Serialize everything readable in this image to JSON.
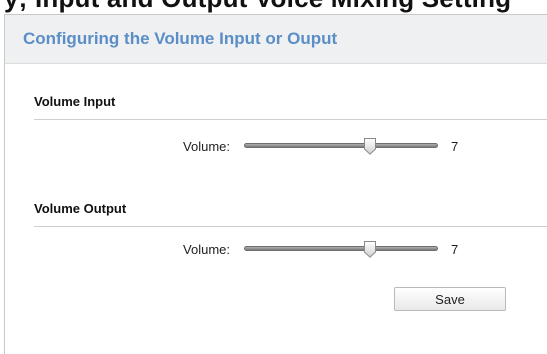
{
  "top_heading": "y; Input and Output Voice Mixing Setting",
  "panel": {
    "title": "Configuring the Volume Input or Ouput"
  },
  "volume_input": {
    "heading": "Volume Input",
    "label": "Volume:",
    "value": 7,
    "level": 0.65
  },
  "volume_output": {
    "heading": "Volume Output",
    "label": "Volume:",
    "value": 7,
    "level": 0.65
  },
  "save_label": "Save",
  "colors": {
    "title": "#5b8ec6",
    "header_bg": "#eef0f2"
  }
}
